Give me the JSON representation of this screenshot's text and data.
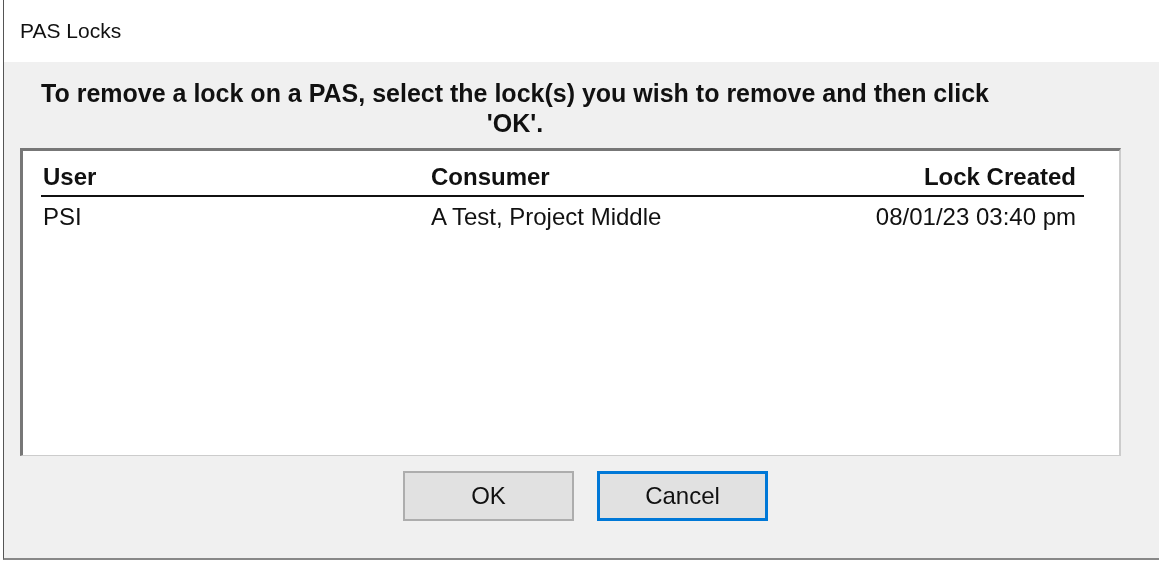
{
  "window": {
    "title": "PAS Locks"
  },
  "instruction": "To remove a lock on a PAS, select the lock(s) you wish to remove and then click 'OK'.",
  "table": {
    "columns": [
      "User",
      "Consumer",
      "Lock Created"
    ],
    "rows": [
      [
        "PSI",
        "A Test, Project Middle",
        "08/01/23 03:40 pm"
      ]
    ]
  },
  "buttons": [
    {
      "label": "OK",
      "focused": false
    },
    {
      "label": "Cancel",
      "focused": true
    }
  ]
}
